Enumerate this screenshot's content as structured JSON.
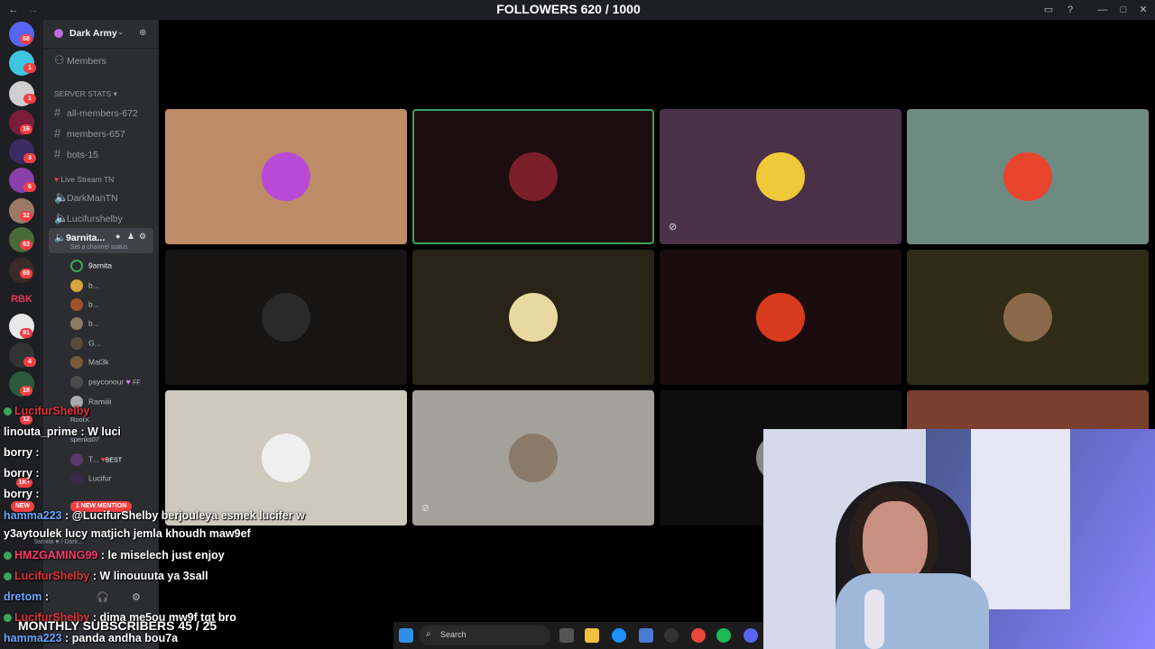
{
  "overlay": {
    "followers_goal": "FOLLOWERS 620 / 1000",
    "subs_goal": "MONTHLY SUBSCRIBERS 45 / 25"
  },
  "server": {
    "name": "Dark Army",
    "members_label": "Members"
  },
  "rail_badges": [
    "68",
    "1",
    "1",
    "1",
    "16",
    "3",
    "6",
    "32",
    "63",
    "69",
    "81",
    "4",
    "18",
    "12",
    "1K+"
  ],
  "channels": {
    "stats_category": "SERVER STATS",
    "stat_channels": [
      "all-members-672",
      "members-657",
      "bots-15"
    ],
    "live_category": "Live Stream TN",
    "voice_channels": [
      "DarkManTN",
      "Lucifurshelby",
      "9arnita..."
    ],
    "channel_status_hint": "Set a channel status",
    "voice_users": [
      "9arnita",
      "b...",
      "b...",
      "b...",
      "G...",
      "Mal3k",
      "psyconour",
      "Ramiiii",
      "RootX",
      "spenks07",
      "T...",
      "Lucifur"
    ],
    "user_tags": {
      "psyconour": "FF",
      "t_best": "BEST"
    },
    "bottom_user": {
      "name": "9arnita",
      "status": "Dark..."
    },
    "mention_badge": "1 NEW MENTION",
    "new_badge": "NEW"
  },
  "stage": {
    "tiles": [
      {
        "bg": "#bd8c66"
      },
      {
        "bg": "#1d0d10"
      },
      {
        "bg": "#4a3148"
      },
      {
        "bg": "#6e8b82"
      },
      {
        "bg": "#161514"
      },
      {
        "bg": "#2a2317"
      },
      {
        "bg": "#1b0d0f"
      },
      {
        "bg": "#2f2b16"
      },
      {
        "bg": "#cdc9bd"
      },
      {
        "bg": "#a4a09a"
      },
      {
        "bg": "#0e0e0e"
      },
      {
        "bg": "#7a3f2f"
      }
    ]
  },
  "chat": [
    {
      "user": "LucifurShelby",
      "text": ""
    },
    {
      "user": "linouta_prime",
      "text": "W luci"
    },
    {
      "user": "borry",
      "text": ""
    },
    {
      "user": "borry",
      "text": ""
    },
    {
      "user": "borry",
      "text": ""
    },
    {
      "user": "hamma223",
      "text": "@LucifurShelby berjouleya esmek lucifer w"
    },
    {
      "user": "",
      "text": "y3aytoulek lucy matjich jemla khoudh maw9ef"
    },
    {
      "user": "HMZGAMING99",
      "text": "le miselech just enjoy"
    },
    {
      "user": "LucifurShelby",
      "text": "W linouuuta ya 3sall"
    },
    {
      "user": "dretom",
      "text": ""
    },
    {
      "user": "LucifurShelby",
      "text": "dima me5ou mw9f tqt bro"
    },
    {
      "user": "hamma223",
      "text": "panda andha bou7a"
    }
  ],
  "taskbar": {
    "search_placeholder": "Search"
  },
  "colors": {
    "discord_bg": "#1e1f22",
    "channels_bg": "#2b2d31",
    "speaking": "#3ba55c",
    "mention": "#f23f43"
  }
}
